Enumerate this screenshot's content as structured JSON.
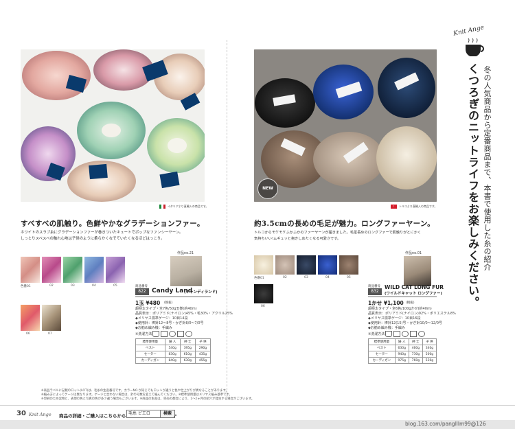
{
  "left": {
    "flag_caption": "イタリアより直輸入の商品です。",
    "headline": "すべすべの肌触り。色鮮やかなグラデーションファー。",
    "desc_line1": "ホワイトのスラブ糸にグラデーションファーが巻きついたキュートでポップなファンシーヤーン。",
    "desc_line2": "しっとりスベスベの触れ心地は子供のように柔らかくなでていたくなるほどはっこり。",
    "work_no": "作品no.21",
    "product_no_label": "商品番号",
    "product_no": "822",
    "product_name": "Candy Land",
    "product_name_jp": "(キャンディランド)",
    "swatch_labels": [
      "色番01",
      "02",
      "03",
      "04",
      "05",
      "06",
      "07"
    ],
    "price": "1玉 ¥480",
    "price_note": "(税抜)",
    "specs": [
      "超極太タイプ・全7色/50g玉巻(約40m)",
      "品質表示：ポリアミド(ナイロン)45%・毛30%・アクリル25%",
      "◆メリヤス標準ゲージ：10目14段",
      "◆使用針：棒針12〜8号・かぎ針8/0〜7/0号",
      "◆お勧め編み機：手編み"
    ],
    "wash_label": "※洗濯方法",
    "table_headers": [
      "標準使用量",
      "婦 人",
      "紳 士",
      "子 供"
    ],
    "table_rows": [
      [
        "ベスト",
        "540g",
        "395g",
        "290g"
      ],
      [
        "セーター",
        "830g",
        "610g",
        "435g"
      ],
      [
        "カーディガン",
        "840g",
        "630g",
        "455g"
      ]
    ]
  },
  "right": {
    "new_badge": "NEW",
    "flag_caption": "トルコより直輸入の商品です。",
    "headline": "約3.5cmの長めの毛足が魅力。ロングファーヤーン。",
    "desc_line1": "トルコからモケモケふかふかのファーヤーンが届きました。毛足長めのロングファーで肌触りがとにかく",
    "desc_line2": "気持ちいい!ムギュッと抱きしめたくなる可愛さです。",
    "work_no": "作品no.01",
    "product_no_label": "商品番号",
    "product_no": "832",
    "product_name": "WILD CAT LONG FUR",
    "product_name_jp": "(ワイルドキャット ロングファー)",
    "swatch_labels": [
      "色番01",
      "02",
      "03",
      "04",
      "05",
      "06"
    ],
    "price": "1かせ ¥1,100",
    "price_note": "(税抜)",
    "specs": [
      "超極太タイプ・全6色/100gかせ(約40m)",
      "品質表示：ポリアミド(ナイロン)92%・ポリエステル8%",
      "◆メリヤス標準ゲージ：10目16段",
      "◆使用針：棒針12(15)号・かぎ針10/0〜12/0号",
      "◆お勧め編み機：手編み"
    ],
    "wash_label": "※洗濯方法",
    "table_headers": [
      "標準使用量",
      "婦 人",
      "紳 士",
      "子 供"
    ],
    "table_rows": [
      [
        "ベスト",
        "630g",
        "460g",
        "340g"
      ],
      [
        "セーター",
        "940g",
        "730g",
        "500g"
      ],
      [
        "カーディガン",
        "975g",
        "760g",
        "530g"
      ]
    ]
  },
  "knit_ange_logo": "Knit Ange",
  "vertical_line1": "冬の人気商品から定番商品まで、本書で使用した糸の紹介",
  "vertical_line2": "くつろぎのニットライフをお楽しみください。",
  "footnote_line1": "※商品ラベルに記載のロット(LOT)は、毛糸の生産番号です。カラーNO.が同じでもロットが違うと色や仕上がりが異なることがあります。",
  "footnote_line2": "※編み方によってゲージは異なります。ゲージと合わない場合は、針の号数を変えて編んでください。※標準使用量はメリヤス編み基準です。",
  "footnote_line3": "※印刷のため実物と、表現の色と写真の色が多少違う場合もございます。※商品の生産は、完売の都合により、1〜2ヶ月の紹介が発生する場合がございます。",
  "footer": {
    "page_number": "30",
    "brand": "Knit Ange",
    "info_text": "商品の詳細・ご購入はこちらから→",
    "search_query": "毛糸 ピエロ",
    "search_button": "検索",
    "watermark": "blog.163.com/panglllm99@126"
  },
  "colors": {
    "accent": "#0a3a6c",
    "paper": "#ffffff"
  }
}
